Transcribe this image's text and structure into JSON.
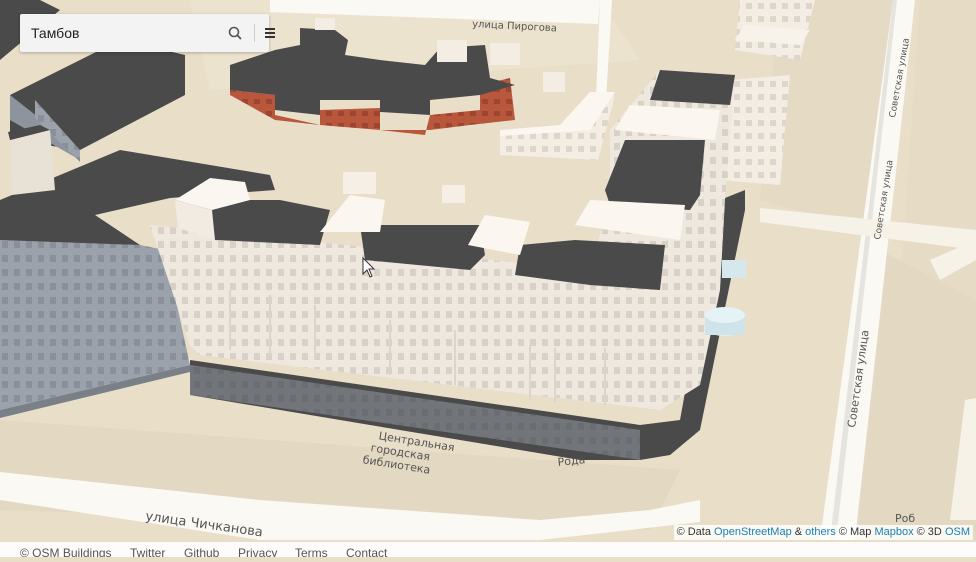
{
  "search": {
    "value": "Тамбов"
  },
  "map": {
    "colors": {
      "land": "#e9dfc9",
      "block": "#efe6d3",
      "road": "#fbf9f3",
      "roof": "#4a4a4a",
      "facade_light": "#efe9e1",
      "facade_grey": "#9aa0a8",
      "facade_brick": "#b8583f"
    },
    "labels": {
      "street_top": "улица Пирогова",
      "street_right_top": "Советская улица",
      "street_right_mid": "Советская улица",
      "street_right_big": "Советская улица",
      "street_bottom": "улица Чичканова",
      "library": [
        "Центральная",
        "городская",
        "библиотека"
      ],
      "partial_bottom": "Рода",
      "partial_right": "Роб"
    }
  },
  "attribution": {
    "prefix": "© Data",
    "osm": "OpenStreetMap",
    "amp": "&",
    "others": "others",
    "map": "© Map",
    "mapbox": "Mapbox",
    "three_d": "© 3D",
    "osm3d": "OSM"
  },
  "footer": {
    "copyright": "© OSM Buildings",
    "twitter": "Twitter",
    "github": "Github",
    "privacy": "Privacy",
    "terms": "Terms",
    "contact": "Contact"
  }
}
